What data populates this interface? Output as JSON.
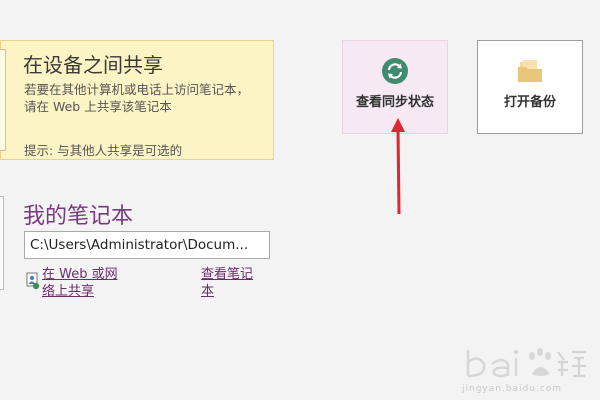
{
  "share_panel": {
    "title": "在设备之间共享",
    "desc_line1": "若要在其他计算机或电话上访问笔记本，",
    "desc_line2": "请在 Web 上共享该笔记本",
    "tip": "提示: 与其他人共享是可选的"
  },
  "tiles": {
    "sync": {
      "label": "查看同步状态",
      "icon": "sync-icon",
      "icon_color": "#3d8c6e"
    },
    "backup": {
      "label": "打开备份",
      "icon": "folder-icon",
      "icon_color": "#e9c77a"
    }
  },
  "my_notebooks": {
    "title": "我的笔记本",
    "path": "C:\\Users\\Administrator\\Docum...",
    "share_web_line1": "在 Web 或网",
    "share_web_line2": "络上共享",
    "view_line1": "查看笔记",
    "view_line2": "本"
  },
  "annotation": {
    "arrow_color": "#e0262f"
  },
  "watermark": {
    "text": "jingyan.baidu.com"
  }
}
